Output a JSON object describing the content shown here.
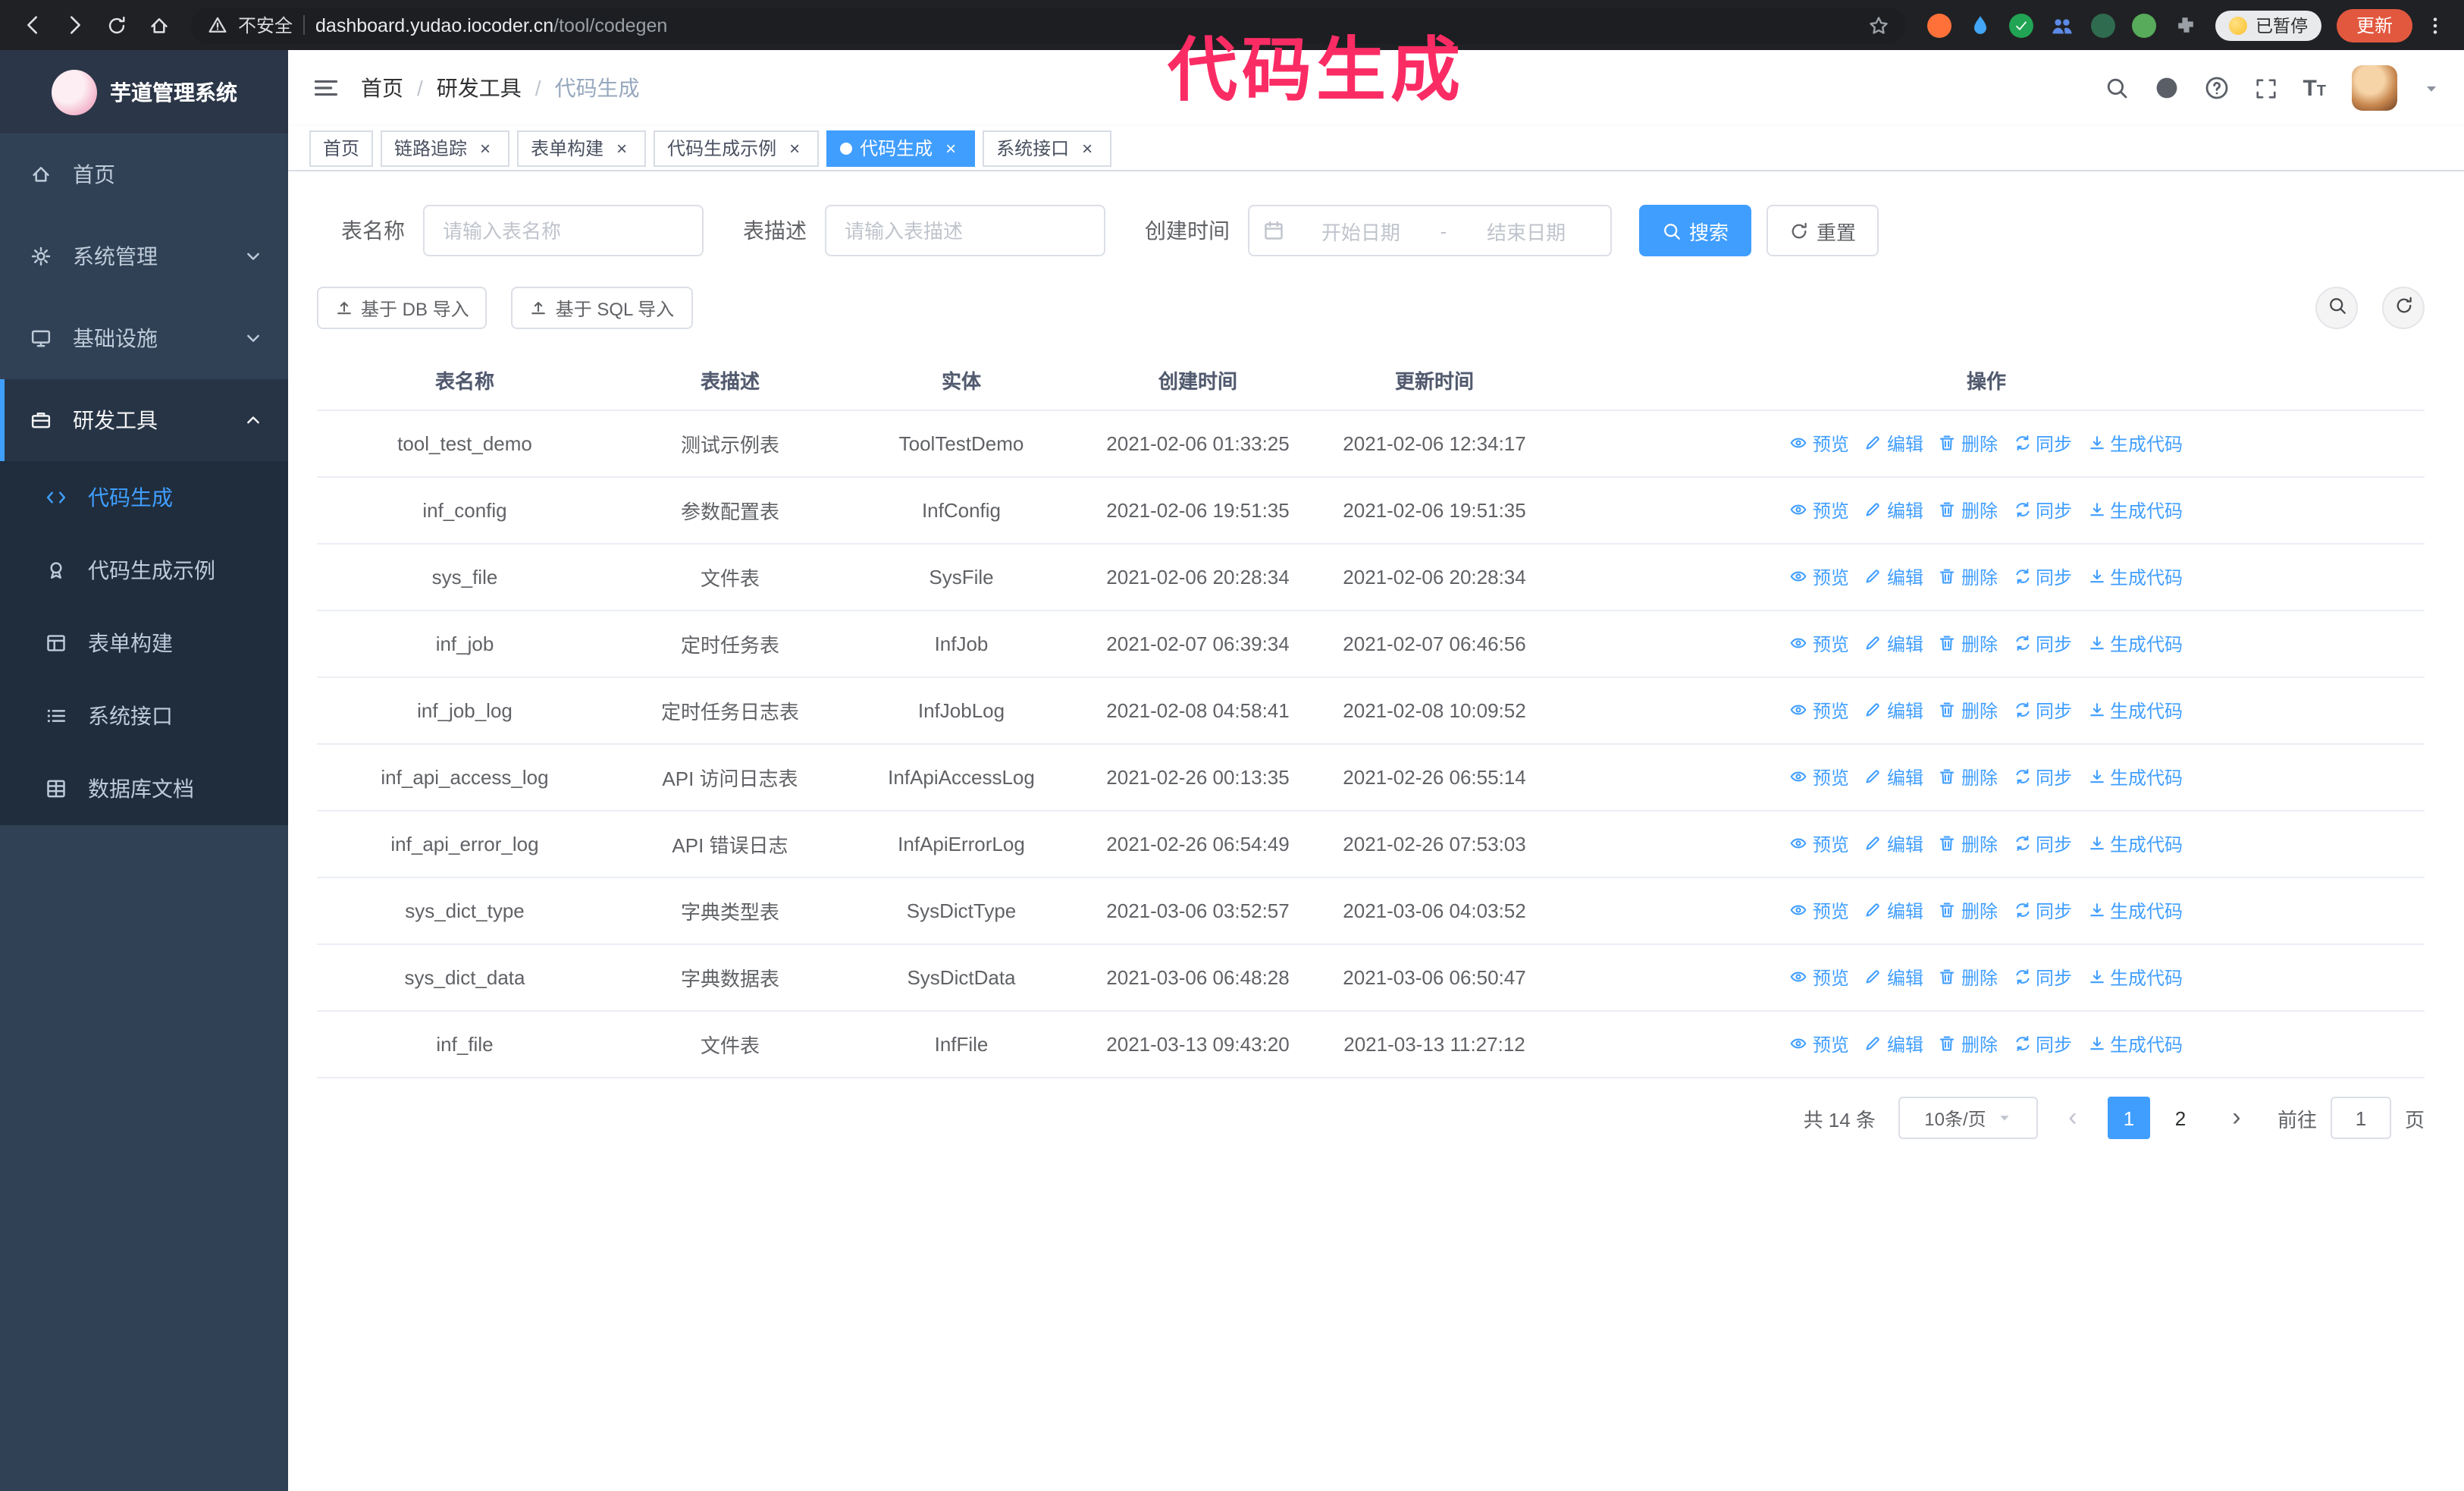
{
  "colors": {
    "primary": "#409eff",
    "sidebar_bg": "#304156",
    "submenu_bg": "#1f2d3d",
    "annotation": "#fb2c64",
    "update_button": "#e2583f"
  },
  "icons": {
    "close": "×"
  },
  "browser": {
    "security_label": "不安全",
    "url_domain": "dashboard.yudao.iocoder.cn",
    "url_path": "/tool/codegen",
    "paused_badge": "已暂停",
    "update_button": "更新",
    "extensions": [
      {
        "name": "extension-fox-icon",
        "color": "#ff7139"
      },
      {
        "name": "extension-drop-icon",
        "color": "#42a5f5"
      },
      {
        "name": "extension-check-icon",
        "color": "#21a453"
      },
      {
        "name": "extension-people-icon",
        "color": "#5c8ae6"
      },
      {
        "name": "extension-chart-icon",
        "color": "#2f6b4f"
      },
      {
        "name": "extension-leaf-icon",
        "color": "#57ab5a"
      },
      {
        "name": "extension-puzzle-icon",
        "color": "#9aa0a6"
      }
    ]
  },
  "annotation": {
    "text": "代码生成"
  },
  "sidebar": {
    "title": "芋道管理系统",
    "menu": [
      {
        "key": "home",
        "label": "首页",
        "icon": "home-icon"
      },
      {
        "key": "system",
        "label": "系统管理",
        "icon": "gear-icon",
        "chevron": "down"
      },
      {
        "key": "infra",
        "label": "基础设施",
        "icon": "monitor-icon",
        "chevron": "down"
      },
      {
        "key": "devtools",
        "label": "研发工具",
        "icon": "toolbox-icon",
        "chevron": "up",
        "active": true,
        "children": [
          {
            "key": "codegen",
            "label": "代码生成",
            "icon": "code-icon",
            "active": true
          },
          {
            "key": "codegen-example",
            "label": "代码生成示例",
            "icon": "badge-icon"
          },
          {
            "key": "form-builder",
            "label": "表单构建",
            "icon": "form-icon"
          },
          {
            "key": "api",
            "label": "系统接口",
            "icon": "api-icon"
          },
          {
            "key": "db-doc",
            "label": "数据库文档",
            "icon": "database-icon"
          }
        ]
      }
    ]
  },
  "header": {
    "breadcrumb": [
      "首页",
      "研发工具",
      "代码生成"
    ]
  },
  "tabs": [
    {
      "key": "home",
      "label": "首页",
      "closable": false
    },
    {
      "key": "tracing",
      "label": "链路追踪",
      "closable": true
    },
    {
      "key": "form-builder",
      "label": "表单构建",
      "closable": true
    },
    {
      "key": "codegen-example",
      "label": "代码生成示例",
      "closable": true
    },
    {
      "key": "codegen",
      "label": "代码生成",
      "closable": true,
      "active": true
    },
    {
      "key": "api",
      "label": "系统接口",
      "closable": true
    }
  ],
  "filters": {
    "table_name_label": "表名称",
    "table_name_placeholder": "请输入表名称",
    "table_desc_label": "表描述",
    "table_desc_placeholder": "请输入表描述",
    "create_time_label": "创建时间",
    "date_start_placeholder": "开始日期",
    "date_separator": "-",
    "date_end_placeholder": "结束日期",
    "search_button": "搜索",
    "reset_button": "重置"
  },
  "toolbar": {
    "import_db": "基于 DB 导入",
    "import_sql": "基于 SQL 导入"
  },
  "table": {
    "columns": [
      "表名称",
      "表描述",
      "实体",
      "创建时间",
      "更新时间",
      "操作"
    ],
    "actions": [
      {
        "key": "preview",
        "label": "预览",
        "icon": "eye-icon"
      },
      {
        "key": "edit",
        "label": "编辑",
        "icon": "edit-icon"
      },
      {
        "key": "delete",
        "label": "删除",
        "icon": "delete-icon"
      },
      {
        "key": "sync",
        "label": "同步",
        "icon": "sync-icon"
      },
      {
        "key": "generate",
        "label": "生成代码",
        "icon": "download-icon"
      }
    ],
    "rows": [
      {
        "name": "tool_test_demo",
        "desc": "测试示例表",
        "entity": "ToolTestDemo",
        "created": "2021-02-06 01:33:25",
        "updated": "2021-02-06 12:34:17"
      },
      {
        "name": "inf_config",
        "desc": "参数配置表",
        "entity": "InfConfig",
        "created": "2021-02-06 19:51:35",
        "updated": "2021-02-06 19:51:35"
      },
      {
        "name": "sys_file",
        "desc": "文件表",
        "entity": "SysFile",
        "created": "2021-02-06 20:28:34",
        "updated": "2021-02-06 20:28:34"
      },
      {
        "name": "inf_job",
        "desc": "定时任务表",
        "entity": "InfJob",
        "created": "2021-02-07 06:39:34",
        "updated": "2021-02-07 06:46:56"
      },
      {
        "name": "inf_job_log",
        "desc": "定时任务日志表",
        "entity": "InfJobLog",
        "created": "2021-02-08 04:58:41",
        "updated": "2021-02-08 10:09:52"
      },
      {
        "name": "inf_api_access_log",
        "desc": "API 访问日志表",
        "entity": "InfApiAccessLog",
        "created": "2021-02-26 00:13:35",
        "updated": "2021-02-26 06:55:14"
      },
      {
        "name": "inf_api_error_log",
        "desc": "API 错误日志",
        "entity": "InfApiErrorLog",
        "created": "2021-02-26 06:54:49",
        "updated": "2021-02-26 07:53:03"
      },
      {
        "name": "sys_dict_type",
        "desc": "字典类型表",
        "entity": "SysDictType",
        "created": "2021-03-06 03:52:57",
        "updated": "2021-03-06 04:03:52"
      },
      {
        "name": "sys_dict_data",
        "desc": "字典数据表",
        "entity": "SysDictData",
        "created": "2021-03-06 06:48:28",
        "updated": "2021-03-06 06:50:47"
      },
      {
        "name": "inf_file",
        "desc": "文件表",
        "entity": "InfFile",
        "created": "2021-03-13 09:43:20",
        "updated": "2021-03-13 11:27:12"
      }
    ]
  },
  "pagination": {
    "total": "共 14 条",
    "page_size": "10条/页",
    "prev_glyph": "‹",
    "next_glyph": "›",
    "pages": [
      "1",
      "2"
    ],
    "active": "1",
    "goto_label": "前往",
    "goto_value": "1",
    "goto_unit": "页"
  }
}
